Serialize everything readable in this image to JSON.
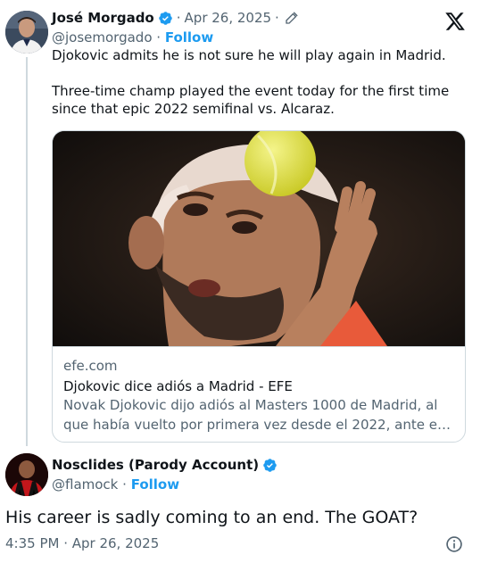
{
  "colors": {
    "accent": "#1d9bf0",
    "text_primary": "#0f1419",
    "text_secondary": "#536471",
    "border": "#cfd9de"
  },
  "quoted_tweet": {
    "author_name": "José Morgado",
    "verified_icon": "verified-badge-icon",
    "separator": "·",
    "date": "Apr 26, 2025",
    "edited_icon": "pencil-icon",
    "handle": "@josemorgado",
    "follow_label": "Follow",
    "text_line_1": "Djokovic admits he is not sure he will play again in Madrid.",
    "text_line_2": "Three-time champ played the event today for the first time since that epic 2022 semifinal vs. Alcaraz.",
    "link_card": {
      "domain": "efe.com",
      "title": "Djokovic dice adiós a Madrid - EFE",
      "description": "Novak Djokovic dijo adiós al Masters 1000 de Madrid, al que había vuelto por primera vez desde el 2022, ante e…"
    }
  },
  "main_tweet": {
    "author_name": "Nosclides (Parody Account)",
    "verified_icon": "verified-badge-icon",
    "handle": "@flamock",
    "separator": "·",
    "follow_label": "Follow",
    "text": "His career is sadly coming to an end. The GOAT?",
    "timestamp": "4:35 PM · Apr 26, 2025",
    "info_icon": "info-icon"
  },
  "brand_icon": "x-logo-icon"
}
